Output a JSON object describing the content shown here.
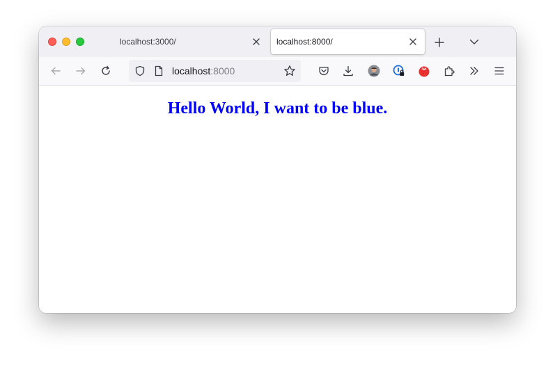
{
  "window": {
    "controls": [
      "close",
      "minimize",
      "zoom"
    ]
  },
  "tabs": [
    {
      "title": "localhost:3000/",
      "active": false
    },
    {
      "title": "localhost:8000/",
      "active": true
    }
  ],
  "tabbar": {
    "new_tab_icon": "plus-icon",
    "list_all_tabs_icon": "chevron-down-icon"
  },
  "toolbar": {
    "back_icon": "arrow-left-icon",
    "forward_icon": "arrow-right-icon",
    "reload_icon": "reload-icon",
    "url": {
      "host": "localhost",
      "port": ":8000"
    },
    "extensions": [
      "pocket-icon",
      "download-icon",
      "avatar",
      "password-manager-icon",
      "tomato-icon",
      "extensions-icon",
      "overflow-icon",
      "menu-icon"
    ]
  },
  "page": {
    "heading": "Hello World, I want to be blue.",
    "heading_color": "#0000ff"
  }
}
